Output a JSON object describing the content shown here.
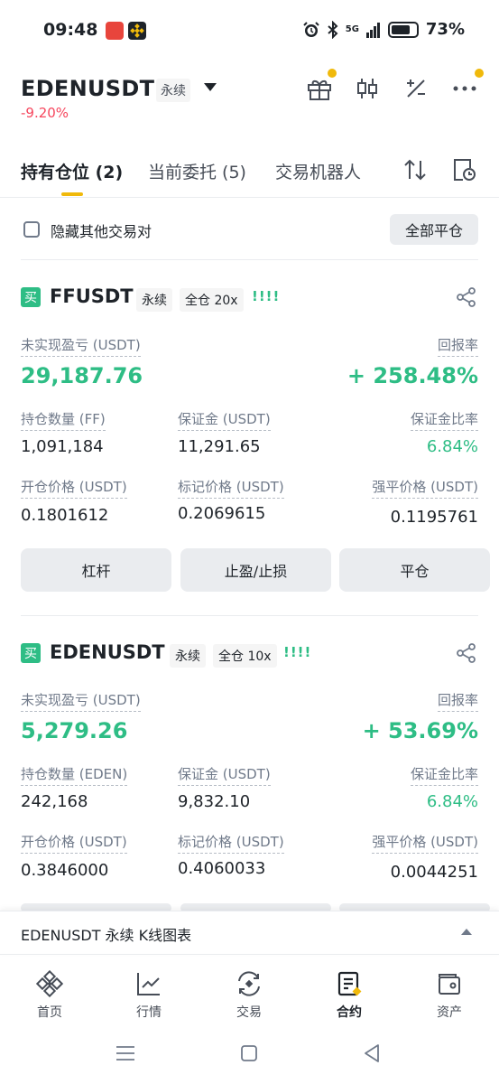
{
  "status_bar": {
    "time": "09:48",
    "network": "5G",
    "battery": "73%",
    "icons": [
      "app-notification-icon",
      "binance-app-icon",
      "alarm-icon",
      "bluetooth-icon",
      "signal-icon",
      "battery-icon"
    ]
  },
  "header": {
    "symbol": "EDENUSDT",
    "contract_type": "永续",
    "change": "-9.20%",
    "icons": [
      "gift-icon",
      "candlestick-icon",
      "calculator-icon",
      "more-icon"
    ]
  },
  "tabs": [
    {
      "label": "持有仓位 (2)",
      "active": true
    },
    {
      "label": "当前委托 (5)",
      "active": false
    },
    {
      "label": "交易机器人",
      "active": false
    }
  ],
  "hide_other_pairs": "隐藏其他交易对",
  "close_all_button": "全部平仓",
  "positions": [
    {
      "side": "买",
      "symbol": "FFUSDT",
      "contract_type": "永续",
      "margin_mode": "全仓 20x",
      "signal": "!!!!",
      "unrealized_pnl_label": "未实现盈亏 (USDT)",
      "unrealized_pnl": "29,187.76",
      "roe_label": "回报率",
      "roe": "+ 258.48%",
      "size_label": "持仓数量 (FF)",
      "size": "1,091,184",
      "margin_label": "保证金 (USDT)",
      "margin": "11,291.65",
      "margin_ratio_label": "保证金比率",
      "margin_ratio": "6.84%",
      "entry_price_label": "开仓价格 (USDT)",
      "entry_price": "0.1801612",
      "mark_price_label": "标记价格 (USDT)",
      "mark_price": "0.2069615",
      "liq_price_label": "强平价格 (USDT)",
      "liq_price": "0.1195761",
      "buttons": [
        "杠杆",
        "止盈/止损",
        "平仓"
      ]
    },
    {
      "side": "买",
      "symbol": "EDENUSDT",
      "contract_type": "永续",
      "margin_mode": "全仓 10x",
      "signal": "!!!!",
      "unrealized_pnl_label": "未实现盈亏 (USDT)",
      "unrealized_pnl": "5,279.26",
      "roe_label": "回报率",
      "roe": "+ 53.69%",
      "size_label": "持仓数量 (EDEN)",
      "size": "242,168",
      "margin_label": "保证金 (USDT)",
      "margin": "9,832.10",
      "margin_ratio_label": "保证金比率",
      "margin_ratio": "6.84%",
      "entry_price_label": "开仓价格 (USDT)",
      "entry_price": "0.3846000",
      "mark_price_label": "标记价格 (USDT)",
      "mark_price": "0.4060033",
      "liq_price_label": "强平价格 (USDT)",
      "liq_price": "0.0044251"
    }
  ],
  "chart_strip": "EDENUSDT 永续 K线图表",
  "bottom_nav": [
    {
      "label": "首页",
      "icon": "home-icon",
      "active": false
    },
    {
      "label": "行情",
      "icon": "market-chart-icon",
      "active": false
    },
    {
      "label": "交易",
      "icon": "trade-icon",
      "active": false
    },
    {
      "label": "合约",
      "icon": "futures-icon",
      "active": true
    },
    {
      "label": "资产",
      "icon": "wallet-icon",
      "active": false
    }
  ],
  "colors": {
    "brand": "#f0b90b",
    "up": "#2ebd85",
    "down": "#f6465d",
    "text": "#1e2329",
    "muted": "#707a8a"
  }
}
